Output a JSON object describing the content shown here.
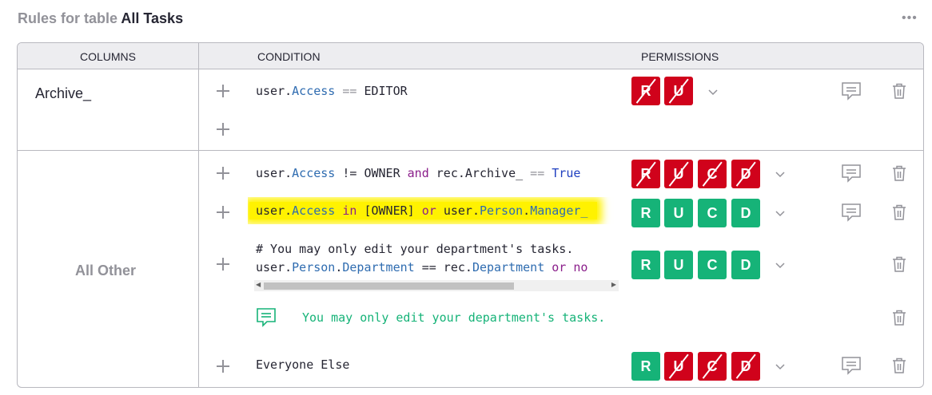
{
  "header": {
    "title_prefix": "Rules for table",
    "table_name": "All Tasks",
    "more_label": "•••"
  },
  "columns": {
    "col_columns": "COLUMNS",
    "col_condition": "CONDITION",
    "col_permissions": "PERMISSIONS"
  },
  "groups": [
    {
      "column_name": "Archive_",
      "rules": [
        {
          "condition_parts": [
            "user",
            ".",
            "Access",
            " == ",
            "EDITOR"
          ],
          "permissions": [
            "R",
            "U"
          ],
          "states": [
            "deny",
            "deny"
          ]
        }
      ]
    },
    {
      "column_name": "All Other",
      "rules": [
        {
          "condition_parts": [
            "user",
            ".",
            "Access",
            " != OWNER ",
            "and",
            " rec.",
            "Archive_",
            " == ",
            "True"
          ],
          "permissions": [
            "R",
            "U",
            "C",
            "D"
          ],
          "states": [
            "deny",
            "deny",
            "deny",
            "deny"
          ]
        },
        {
          "condition_parts": [
            "user",
            ".",
            "Access",
            " in ",
            "[OWNER]",
            " or ",
            "user",
            ".",
            "Person",
            ".",
            "Manager_"
          ],
          "permissions": [
            "R",
            "U",
            "C",
            "D"
          ],
          "states": [
            "allow",
            "allow",
            "allow",
            "allow"
          ]
        },
        {
          "comment_line": "# You may only edit your department's tasks.",
          "condition_parts": [
            "user",
            ".",
            "Person",
            ".",
            "Department",
            " == rec.",
            "Department",
            " or no"
          ],
          "permissions": [
            "R",
            "U",
            "C",
            "D"
          ],
          "states": [
            "allow",
            "allow",
            "allow",
            "allow"
          ]
        },
        {
          "memo": "You may only edit your department's tasks."
        },
        {
          "condition_text": "Everyone Else",
          "permissions": [
            "R",
            "U",
            "C",
            "D"
          ],
          "states": [
            "allow",
            "deny",
            "deny",
            "deny"
          ]
        }
      ]
    }
  ],
  "colors": {
    "allow": "#16b378",
    "deny": "#d0021b",
    "highlight": "#fff200",
    "comment_green": "#16b378"
  },
  "icons": [
    "more-icon",
    "plus-icon",
    "chevron-down-icon",
    "memo-icon",
    "trash-icon"
  ]
}
